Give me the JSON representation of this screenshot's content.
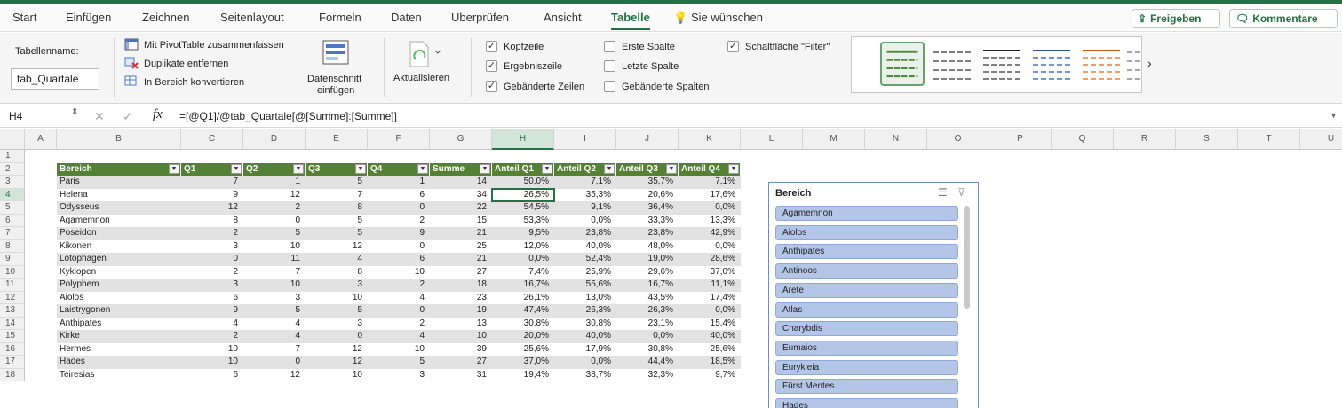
{
  "menu": {
    "tabs": [
      "Start",
      "Einfügen",
      "Zeichnen",
      "Seitenlayout",
      "Formeln",
      "Daten",
      "Überprüfen",
      "Ansicht",
      "Tabelle"
    ],
    "tellme": "Sie wünschen",
    "share": "Freigeben",
    "comments": "Kommentare",
    "accent": "#217346"
  },
  "ribbon": {
    "tablename_label": "Tabellenname:",
    "tablename_value": "tab_Quartale",
    "pivot": "Mit PivotTable zusammenfassen",
    "dedupe": "Duplikate entfernen",
    "convert": "In Bereich konvertieren",
    "slicer_l1": "Datenschnitt",
    "slicer_l2": "einfügen",
    "refresh": "Aktualisieren",
    "opt_header": "Kopfzeile",
    "opt_total": "Ergebniszeile",
    "opt_banded_rows": "Gebänderte Zeilen",
    "opt_first_col": "Erste Spalte",
    "opt_last_col": "Letzte Spalte",
    "opt_banded_cols": "Gebänderte Spalten",
    "opt_filter": "Schaltfläche \"Filter\"",
    "checks": {
      "header": true,
      "total": true,
      "banded_rows": true,
      "first_col": false,
      "last_col": false,
      "banded_cols": false,
      "filter": true
    },
    "check_mark": "✓"
  },
  "formula": {
    "cellref": "H4",
    "fx": "fx",
    "content": "=[@Q1]/@tab_Quartale[@[Summe]:[Summe]]"
  },
  "sheet": {
    "columns": [
      "A",
      "B",
      "C",
      "D",
      "E",
      "F",
      "G",
      "H",
      "I",
      "J",
      "K",
      "L",
      "M",
      "N",
      "O",
      "P",
      "Q",
      "R",
      "S",
      "T",
      "U"
    ],
    "rows": [
      "1",
      "2",
      "3",
      "4",
      "5",
      "6",
      "7",
      "8",
      "9",
      "10",
      "11",
      "12",
      "13",
      "14",
      "15",
      "16",
      "17",
      "18"
    ],
    "headers": [
      "Bereich",
      "Q1",
      "Q2",
      "Q3",
      "Q4",
      "Summe",
      "Anteil Q1",
      "Anteil Q2",
      "Anteil Q3",
      "Anteil Q4"
    ],
    "header_color": "#548235",
    "band_color": "#e2e2e2",
    "data": [
      [
        "Paris",
        "7",
        "1",
        "5",
        "1",
        "14",
        "50,0%",
        "7,1%",
        "35,7%",
        "7,1%"
      ],
      [
        "Helena",
        "9",
        "12",
        "7",
        "6",
        "34",
        "26,5%",
        "35,3%",
        "20,6%",
        "17,6%"
      ],
      [
        "Odysseus",
        "12",
        "2",
        "8",
        "0",
        "22",
        "54,5%",
        "9,1%",
        "36,4%",
        "0,0%"
      ],
      [
        "Agamemnon",
        "8",
        "0",
        "5",
        "2",
        "15",
        "53,3%",
        "0,0%",
        "33,3%",
        "13,3%"
      ],
      [
        "Poseidon",
        "2",
        "5",
        "5",
        "9",
        "21",
        "9,5%",
        "23,8%",
        "23,8%",
        "42,9%"
      ],
      [
        "Kikonen",
        "3",
        "10",
        "12",
        "0",
        "25",
        "12,0%",
        "40,0%",
        "48,0%",
        "0,0%"
      ],
      [
        "Lotophagen",
        "0",
        "11",
        "4",
        "6",
        "21",
        "0,0%",
        "52,4%",
        "19,0%",
        "28,6%"
      ],
      [
        "Kyklopen",
        "2",
        "7",
        "8",
        "10",
        "27",
        "7,4%",
        "25,9%",
        "29,6%",
        "37,0%"
      ],
      [
        "Polyphem",
        "3",
        "10",
        "3",
        "2",
        "18",
        "16,7%",
        "55,6%",
        "16,7%",
        "11,1%"
      ],
      [
        "Aiolos",
        "6",
        "3",
        "10",
        "4",
        "23",
        "26,1%",
        "13,0%",
        "43,5%",
        "17,4%"
      ],
      [
        "Laistrygonen",
        "9",
        "5",
        "5",
        "0",
        "19",
        "47,4%",
        "26,3%",
        "26,3%",
        "0,0%"
      ],
      [
        "Anthipates",
        "4",
        "4",
        "3",
        "2",
        "13",
        "30,8%",
        "30,8%",
        "23,1%",
        "15,4%"
      ],
      [
        "Kirke",
        "2",
        "4",
        "0",
        "4",
        "10",
        "20,0%",
        "40,0%",
        "0,0%",
        "40,0%"
      ],
      [
        "Hermes",
        "10",
        "7",
        "12",
        "10",
        "39",
        "25,6%",
        "17,9%",
        "30,8%",
        "25,6%"
      ],
      [
        "Hades",
        "10",
        "0",
        "12",
        "5",
        "27",
        "37,0%",
        "0,0%",
        "44,4%",
        "18,5%"
      ],
      [
        "Teiresias",
        "6",
        "12",
        "10",
        "3",
        "31",
        "19,4%",
        "38,7%",
        "32,3%",
        "9,7%"
      ]
    ]
  },
  "slicer": {
    "title": "Bereich",
    "items": [
      "Agamemnon",
      "Aiolos",
      "Anthipates",
      "Antinoos",
      "Arete",
      "Atlas",
      "Charybdis",
      "Eumaios",
      "Eurykleia",
      "Fürst Mentes",
      "Hades"
    ]
  }
}
